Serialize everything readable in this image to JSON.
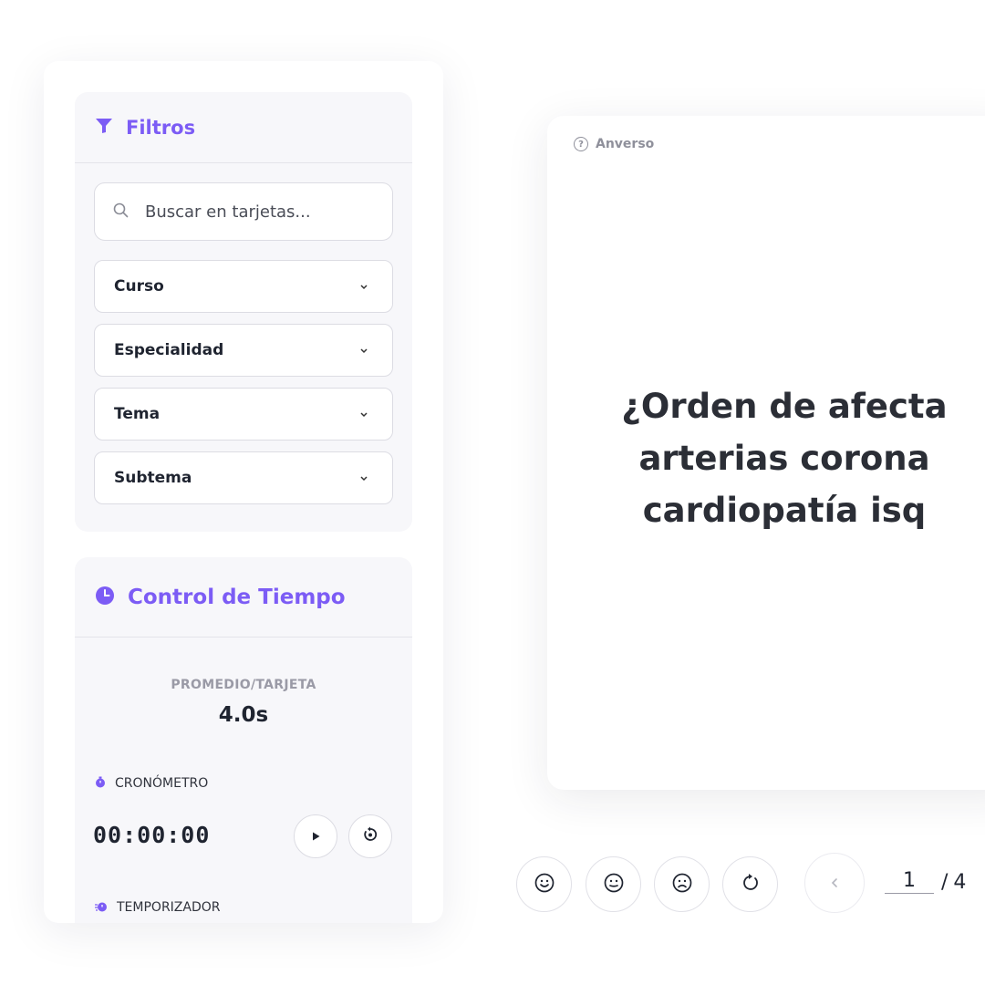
{
  "filters": {
    "title": "Filtros",
    "search_placeholder": "Buscar en tarjetas...",
    "selects": [
      {
        "label": "Curso"
      },
      {
        "label": "Especialidad"
      },
      {
        "label": "Tema"
      },
      {
        "label": "Subtema"
      }
    ]
  },
  "time_control": {
    "title": "Control de Tiempo",
    "average_label": "PROMEDIO/TARJETA",
    "average_value": "4.0s",
    "stopwatch_label": "CRONÓMETRO",
    "stopwatch_value": "00:00:00",
    "timer_label": "TEMPORIZADOR"
  },
  "card": {
    "side_label": "Anverso",
    "question_lines": [
      "¿Orden de afecta",
      "arterias corona",
      "cardiopatía isq"
    ]
  },
  "pagination": {
    "current": "1",
    "separator": "/",
    "total": "4"
  },
  "icons": {
    "filter": "filter-icon",
    "clock": "clock-icon",
    "search": "search-icon",
    "stopwatch": "stopwatch-icon",
    "timer": "timer-icon",
    "play": "play-icon",
    "reset": "reset-icon",
    "easy": "smile-icon",
    "medium": "neutral-face-icon",
    "hard": "sad-face-icon",
    "repeat": "repeat-icon",
    "prev": "chevron-left-icon",
    "question": "question-circle-icon"
  },
  "colors": {
    "accent": "#7c5cf5",
    "text": "#1f2430",
    "muted": "#9a9aa6"
  }
}
